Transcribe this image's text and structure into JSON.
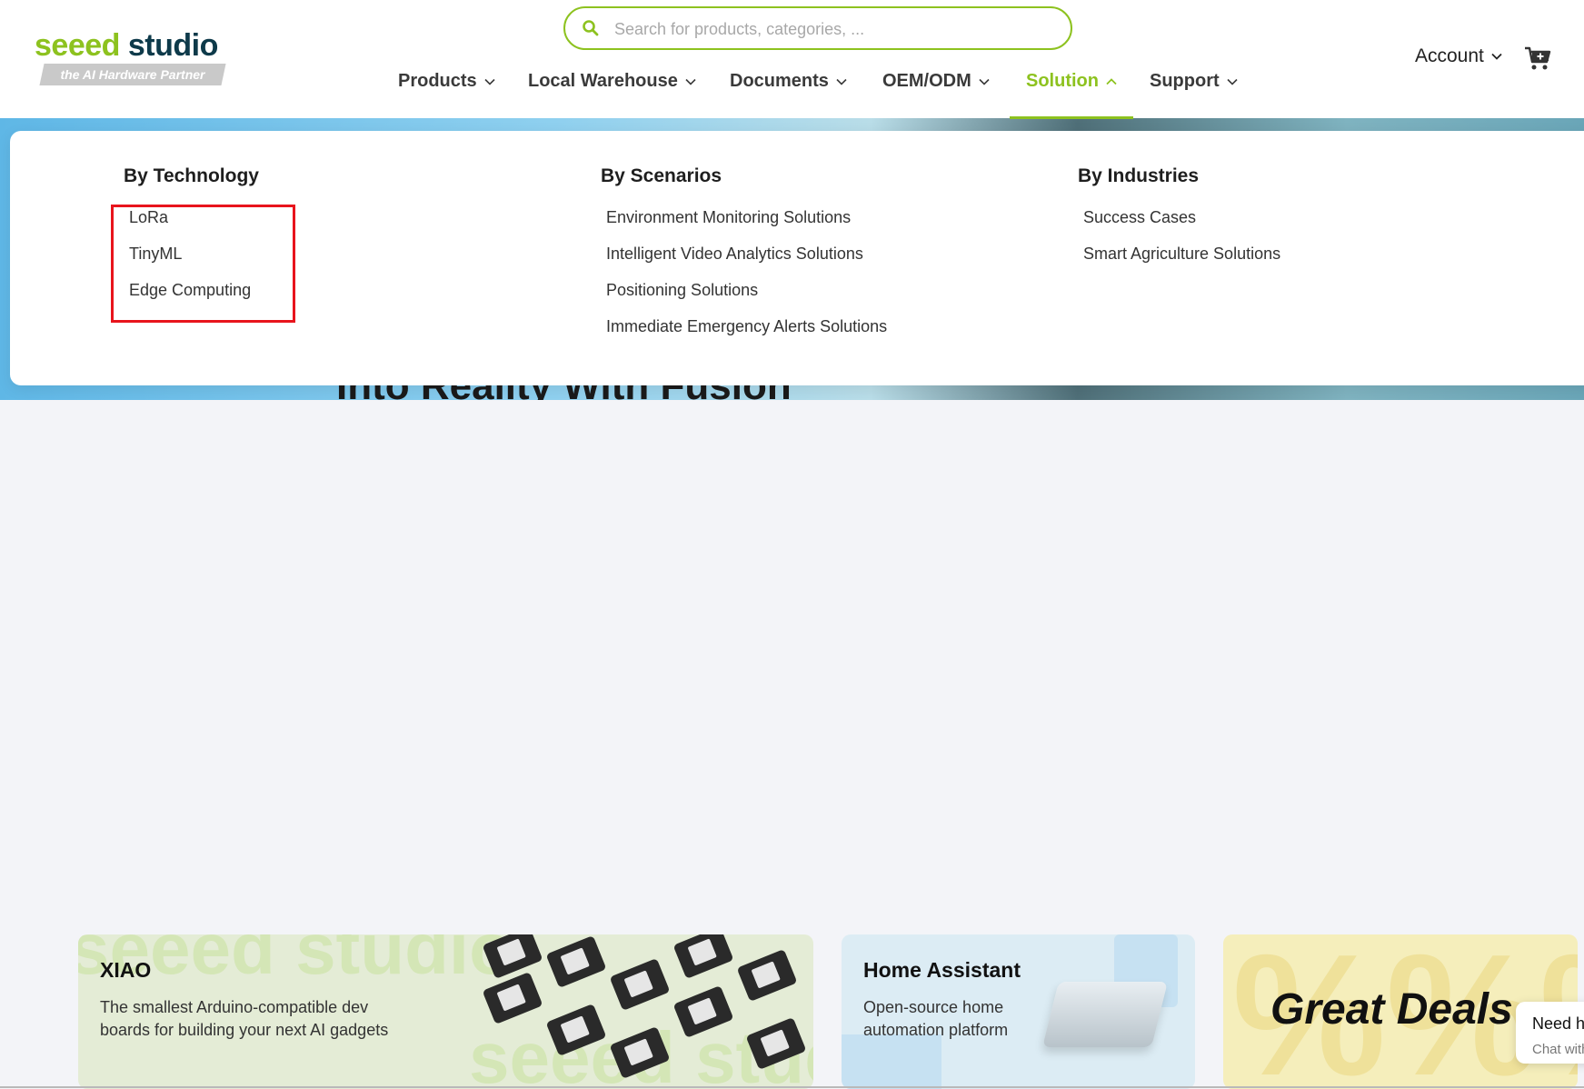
{
  "logo": {
    "word_green": "seeed",
    "word_dark": " studio",
    "tagline": "the AI Hardware Partner"
  },
  "search": {
    "placeholder": "Search for products, categories, ..."
  },
  "nav": {
    "items": [
      {
        "label": "Products"
      },
      {
        "label": "Local Warehouse"
      },
      {
        "label": "Documents"
      },
      {
        "label": "OEM/ODM"
      },
      {
        "label": "Solution"
      },
      {
        "label": "Support"
      }
    ],
    "active": "Solution"
  },
  "account": {
    "label": "Account"
  },
  "hero": {
    "text": "Into Reality With Fusion"
  },
  "dropdown": {
    "columns": [
      {
        "title": "By Technology",
        "links": [
          "LoRa",
          "TinyML",
          "Edge Computing"
        ]
      },
      {
        "title": "By Scenarios",
        "links": [
          "Environment Monitoring Solutions",
          "Intelligent Video Analytics Solutions",
          "Positioning Solutions",
          "Immediate Emergency Alerts Solutions"
        ]
      },
      {
        "title": "By Industries",
        "links": [
          "Success Cases",
          "Smart Agriculture Solutions"
        ]
      }
    ]
  },
  "cards": {
    "xiao": {
      "title": "XIAO",
      "desc_line1": "The smallest Arduino-compatible dev",
      "desc_line2": "boards for building your next AI gadgets",
      "watermark": "seeed studio"
    },
    "ha": {
      "title": "Home Assistant",
      "desc_line1": "Open-source home",
      "desc_line2": "automation platform"
    },
    "deals": {
      "title": "Great Deals",
      "bg": "%%%"
    }
  },
  "chat": {
    "title": "Need help?",
    "sub": "Chat with us"
  },
  "colors": {
    "brand_green": "#8dc21f",
    "brand_dark": "#0e3a4a",
    "highlight_red": "#e8141c"
  }
}
